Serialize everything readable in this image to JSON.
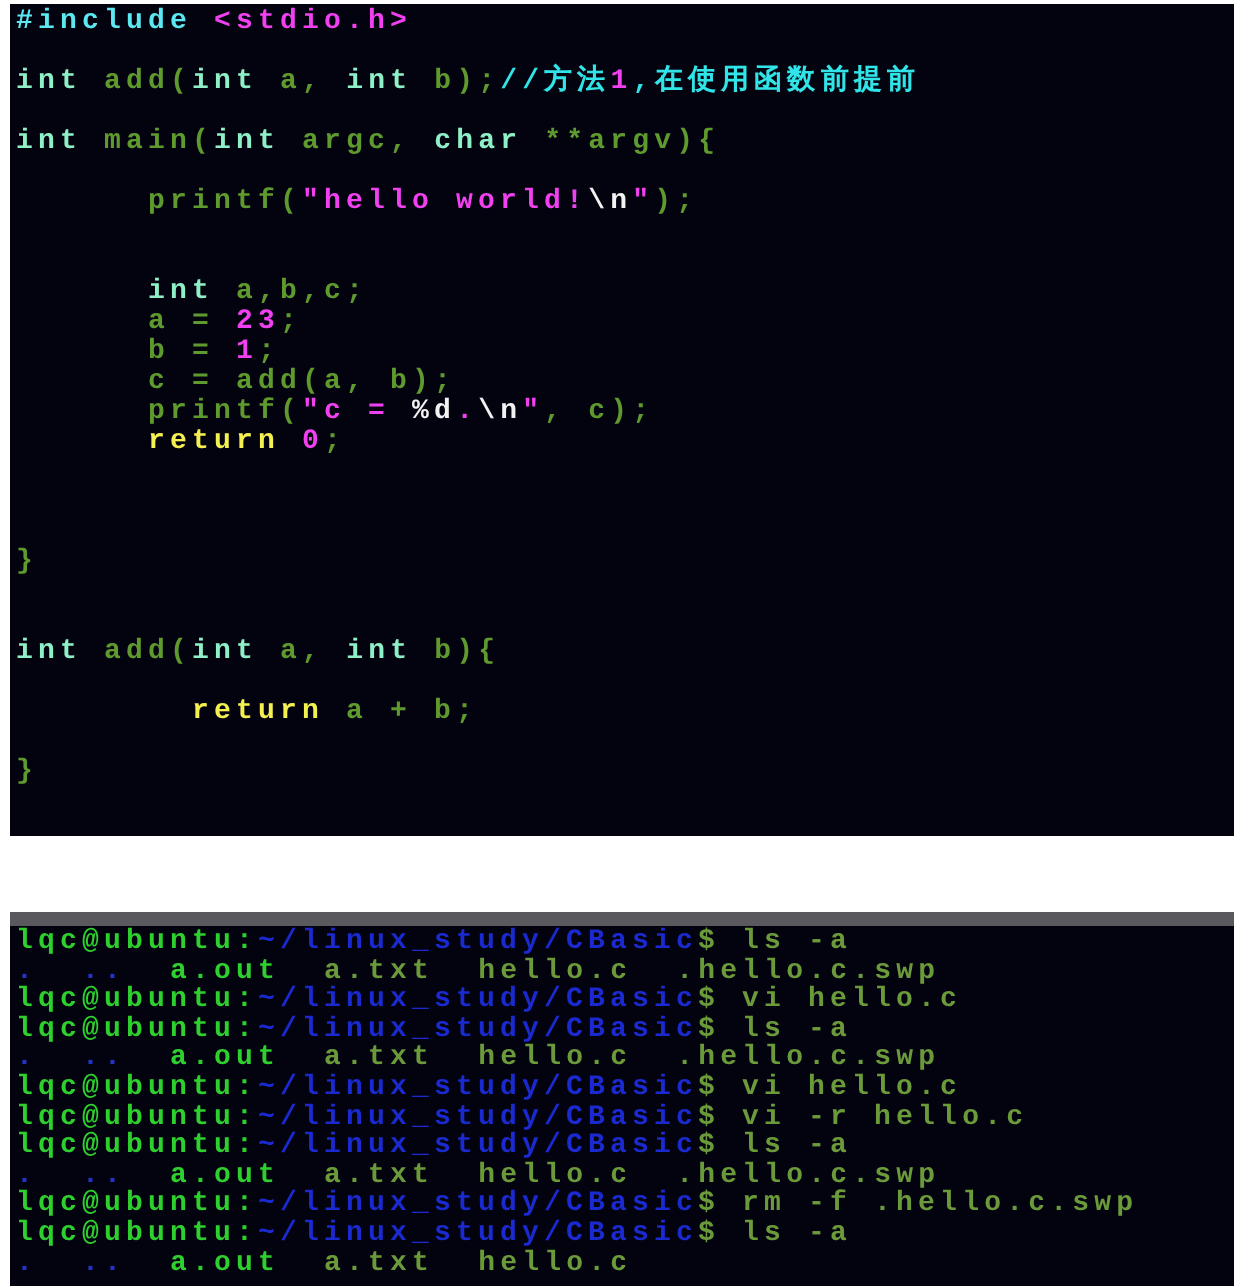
{
  "editor": {
    "lines": [
      {
        "kind": "code",
        "tokens": [
          {
            "kind": "pre",
            "text": "#include "
          },
          {
            "kind": "header",
            "text": "<stdio.h>"
          }
        ]
      },
      {
        "kind": "blank"
      },
      {
        "kind": "code",
        "tokens": [
          {
            "kind": "type",
            "text": "int"
          },
          {
            "kind": "ident",
            "text": " add("
          },
          {
            "kind": "type",
            "text": "int"
          },
          {
            "kind": "ident",
            "text": " a, "
          },
          {
            "kind": "type",
            "text": "int"
          },
          {
            "kind": "ident",
            "text": " b);"
          },
          {
            "kind": "comment",
            "text": "//方法"
          },
          {
            "kind": "num",
            "text": "1"
          },
          {
            "kind": "comment",
            "text": ",在使用函数前提前"
          }
        ]
      },
      {
        "kind": "blank"
      },
      {
        "kind": "code",
        "tokens": [
          {
            "kind": "type",
            "text": "int"
          },
          {
            "kind": "ident",
            "text": " main("
          },
          {
            "kind": "type",
            "text": "int"
          },
          {
            "kind": "ident",
            "text": " argc, "
          },
          {
            "kind": "type",
            "text": "char"
          },
          {
            "kind": "ident",
            "text": " **argv){"
          }
        ]
      },
      {
        "kind": "blank"
      },
      {
        "kind": "code",
        "tokens": [
          {
            "kind": "ident",
            "text": "      printf("
          },
          {
            "kind": "str",
            "text": "\"hello world!"
          },
          {
            "kind": "esc",
            "text": "\\n"
          },
          {
            "kind": "str",
            "text": "\""
          },
          {
            "kind": "ident",
            "text": ");"
          }
        ]
      },
      {
        "kind": "blank"
      },
      {
        "kind": "blank"
      },
      {
        "kind": "code",
        "tokens": [
          {
            "kind": "type",
            "text": "      int"
          },
          {
            "kind": "ident",
            "text": " a,b,c;"
          }
        ]
      },
      {
        "kind": "code",
        "tokens": [
          {
            "kind": "ident",
            "text": "      a = "
          },
          {
            "kind": "num",
            "text": "23"
          },
          {
            "kind": "ident",
            "text": ";"
          }
        ]
      },
      {
        "kind": "code",
        "tokens": [
          {
            "kind": "ident",
            "text": "      b = "
          },
          {
            "kind": "num",
            "text": "1"
          },
          {
            "kind": "ident",
            "text": ";"
          }
        ]
      },
      {
        "kind": "code",
        "tokens": [
          {
            "kind": "ident",
            "text": "      c = add(a, b);"
          }
        ]
      },
      {
        "kind": "code",
        "tokens": [
          {
            "kind": "ident",
            "text": "      printf("
          },
          {
            "kind": "str",
            "text": "\"c = "
          },
          {
            "kind": "esc",
            "text": "%d"
          },
          {
            "kind": "str",
            "text": "."
          },
          {
            "kind": "esc",
            "text": "\\n"
          },
          {
            "kind": "str",
            "text": "\""
          },
          {
            "kind": "ident",
            "text": ", c);"
          }
        ]
      },
      {
        "kind": "code",
        "tokens": [
          {
            "kind": "kw",
            "text": "      return "
          },
          {
            "kind": "num",
            "text": "0"
          },
          {
            "kind": "ident",
            "text": ";"
          }
        ]
      },
      {
        "kind": "blank"
      },
      {
        "kind": "blank"
      },
      {
        "kind": "blank"
      },
      {
        "kind": "code",
        "tokens": [
          {
            "kind": "ident",
            "text": "}"
          }
        ]
      },
      {
        "kind": "blank"
      },
      {
        "kind": "blank"
      },
      {
        "kind": "code",
        "tokens": [
          {
            "kind": "type",
            "text": "int"
          },
          {
            "kind": "ident",
            "text": " add("
          },
          {
            "kind": "type",
            "text": "int"
          },
          {
            "kind": "ident",
            "text": " a, "
          },
          {
            "kind": "type",
            "text": "int"
          },
          {
            "kind": "ident",
            "text": " b){"
          }
        ]
      },
      {
        "kind": "blank"
      },
      {
        "kind": "code",
        "tokens": [
          {
            "kind": "kw",
            "text": "        return"
          },
          {
            "kind": "ident",
            "text": " a + b;"
          }
        ]
      },
      {
        "kind": "blank"
      },
      {
        "kind": "code",
        "tokens": [
          {
            "kind": "ident",
            "text": "}"
          }
        ]
      }
    ]
  },
  "terminal": {
    "lines": [
      {
        "kind": "prompt",
        "user": "lqc@ubuntu:",
        "path": "~/linux_study/CBasic",
        "command": "$ ls -a"
      },
      {
        "kind": "listing",
        "entries": [
          {
            "kind": "dir",
            "text": "."
          },
          {
            "kind": "dir",
            "text": ".."
          },
          {
            "kind": "exe",
            "text": "a.out"
          },
          {
            "kind": "file",
            "text": "a.txt"
          },
          {
            "kind": "file",
            "text": "hello.c"
          },
          {
            "kind": "file",
            "text": ".hello.c.swp"
          }
        ]
      },
      {
        "kind": "prompt",
        "user": "lqc@ubuntu:",
        "path": "~/linux_study/CBasic",
        "command": "$ vi hello.c"
      },
      {
        "kind": "prompt",
        "user": "lqc@ubuntu:",
        "path": "~/linux_study/CBasic",
        "command": "$ ls -a"
      },
      {
        "kind": "listing",
        "entries": [
          {
            "kind": "dir",
            "text": "."
          },
          {
            "kind": "dir",
            "text": ".."
          },
          {
            "kind": "exe",
            "text": "a.out"
          },
          {
            "kind": "file",
            "text": "a.txt"
          },
          {
            "kind": "file",
            "text": "hello.c"
          },
          {
            "kind": "file",
            "text": ".hello.c.swp"
          }
        ]
      },
      {
        "kind": "prompt",
        "user": "lqc@ubuntu:",
        "path": "~/linux_study/CBasic",
        "command": "$ vi hello.c"
      },
      {
        "kind": "prompt",
        "user": "lqc@ubuntu:",
        "path": "~/linux_study/CBasic",
        "command": "$ vi -r hello.c"
      },
      {
        "kind": "prompt",
        "user": "lqc@ubuntu:",
        "path": "~/linux_study/CBasic",
        "command": "$ ls -a"
      },
      {
        "kind": "listing",
        "entries": [
          {
            "kind": "dir",
            "text": "."
          },
          {
            "kind": "dir",
            "text": ".."
          },
          {
            "kind": "exe",
            "text": "a.out"
          },
          {
            "kind": "file",
            "text": "a.txt"
          },
          {
            "kind": "file",
            "text": "hello.c"
          },
          {
            "kind": "file",
            "text": ".hello.c.swp"
          }
        ]
      },
      {
        "kind": "prompt",
        "user": "lqc@ubuntu:",
        "path": "~/linux_study/CBasic",
        "command": "$ rm -f .hello.c.swp"
      },
      {
        "kind": "prompt",
        "user": "lqc@ubuntu:",
        "path": "~/linux_study/CBasic",
        "command": "$ ls -a"
      },
      {
        "kind": "listing",
        "entries": [
          {
            "kind": "dir",
            "text": "."
          },
          {
            "kind": "dir",
            "text": ".."
          },
          {
            "kind": "exe",
            "text": "a.out"
          },
          {
            "kind": "file",
            "text": "a.txt"
          },
          {
            "kind": "file",
            "text": "hello.c"
          }
        ]
      }
    ]
  }
}
